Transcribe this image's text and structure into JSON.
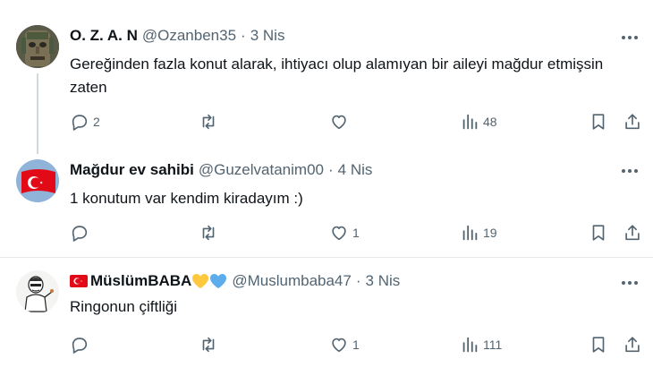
{
  "tweets": [
    {
      "name": "O. Z. A. N",
      "handle": "@Ozanben35",
      "separator": "·",
      "date": "3 Nis",
      "text": "Gereğinden fazla konut alarak, ihtiyacı olup alamıyan bir aileyi mağdur etmişsin zaten",
      "replies": "2",
      "retweets": "",
      "likes": "",
      "views": "48",
      "avatar_icon": "stone-statue-avatar"
    },
    {
      "name": "Mağdur ev sahibi",
      "handle": "@Guzelvatanim00",
      "separator": "·",
      "date": "4 Nis",
      "text": "1 konutum var kendim kiradayım :)",
      "replies": "",
      "retweets": "",
      "likes": "1",
      "views": "19",
      "avatar_icon": "turkish-flag-avatar"
    },
    {
      "name": "MüslümBABA",
      "handle": "@Muslumbaba47",
      "separator": "·",
      "date": "3 Nis",
      "text": "Ringonun çiftliği",
      "replies": "",
      "retweets": "",
      "likes": "1",
      "views": "111",
      "avatar_icon": "cartoon-man-avatar",
      "name_emojis": [
        "turkish-flag-emoji",
        "yellow-heart-emoji",
        "blue-heart-emoji"
      ]
    }
  ],
  "colors": {
    "text": "#0f1419",
    "secondary": "#536471",
    "divider": "#e7ebee",
    "thread_line": "#cfd9de",
    "flag_red": "#e30a17",
    "yellow_heart": "#ffc83d",
    "blue_heart": "#5dadec"
  }
}
